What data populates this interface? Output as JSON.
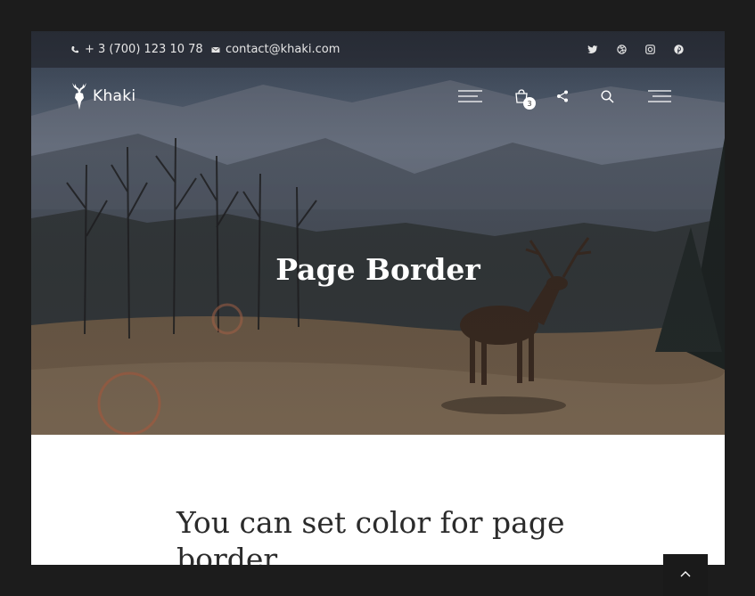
{
  "topbar": {
    "phone": "+ 3 (700) 123 10 78",
    "email": "contact@khaki.com",
    "social": [
      "twitter-icon",
      "dribbble-icon",
      "instagram-icon",
      "pinterest-icon"
    ]
  },
  "header": {
    "logo_text": "Khaki",
    "cart_count": "3",
    "icons": [
      "menu-icon",
      "cart-icon",
      "share-icon",
      "search-icon",
      "side-menu-icon"
    ]
  },
  "hero": {
    "title": "Page Border"
  },
  "content": {
    "heading": "You can set color for page border"
  },
  "colors": {
    "page_border": "#1c1c1c",
    "content_background": "#ffffff",
    "heading_text": "#2b2b2b"
  }
}
